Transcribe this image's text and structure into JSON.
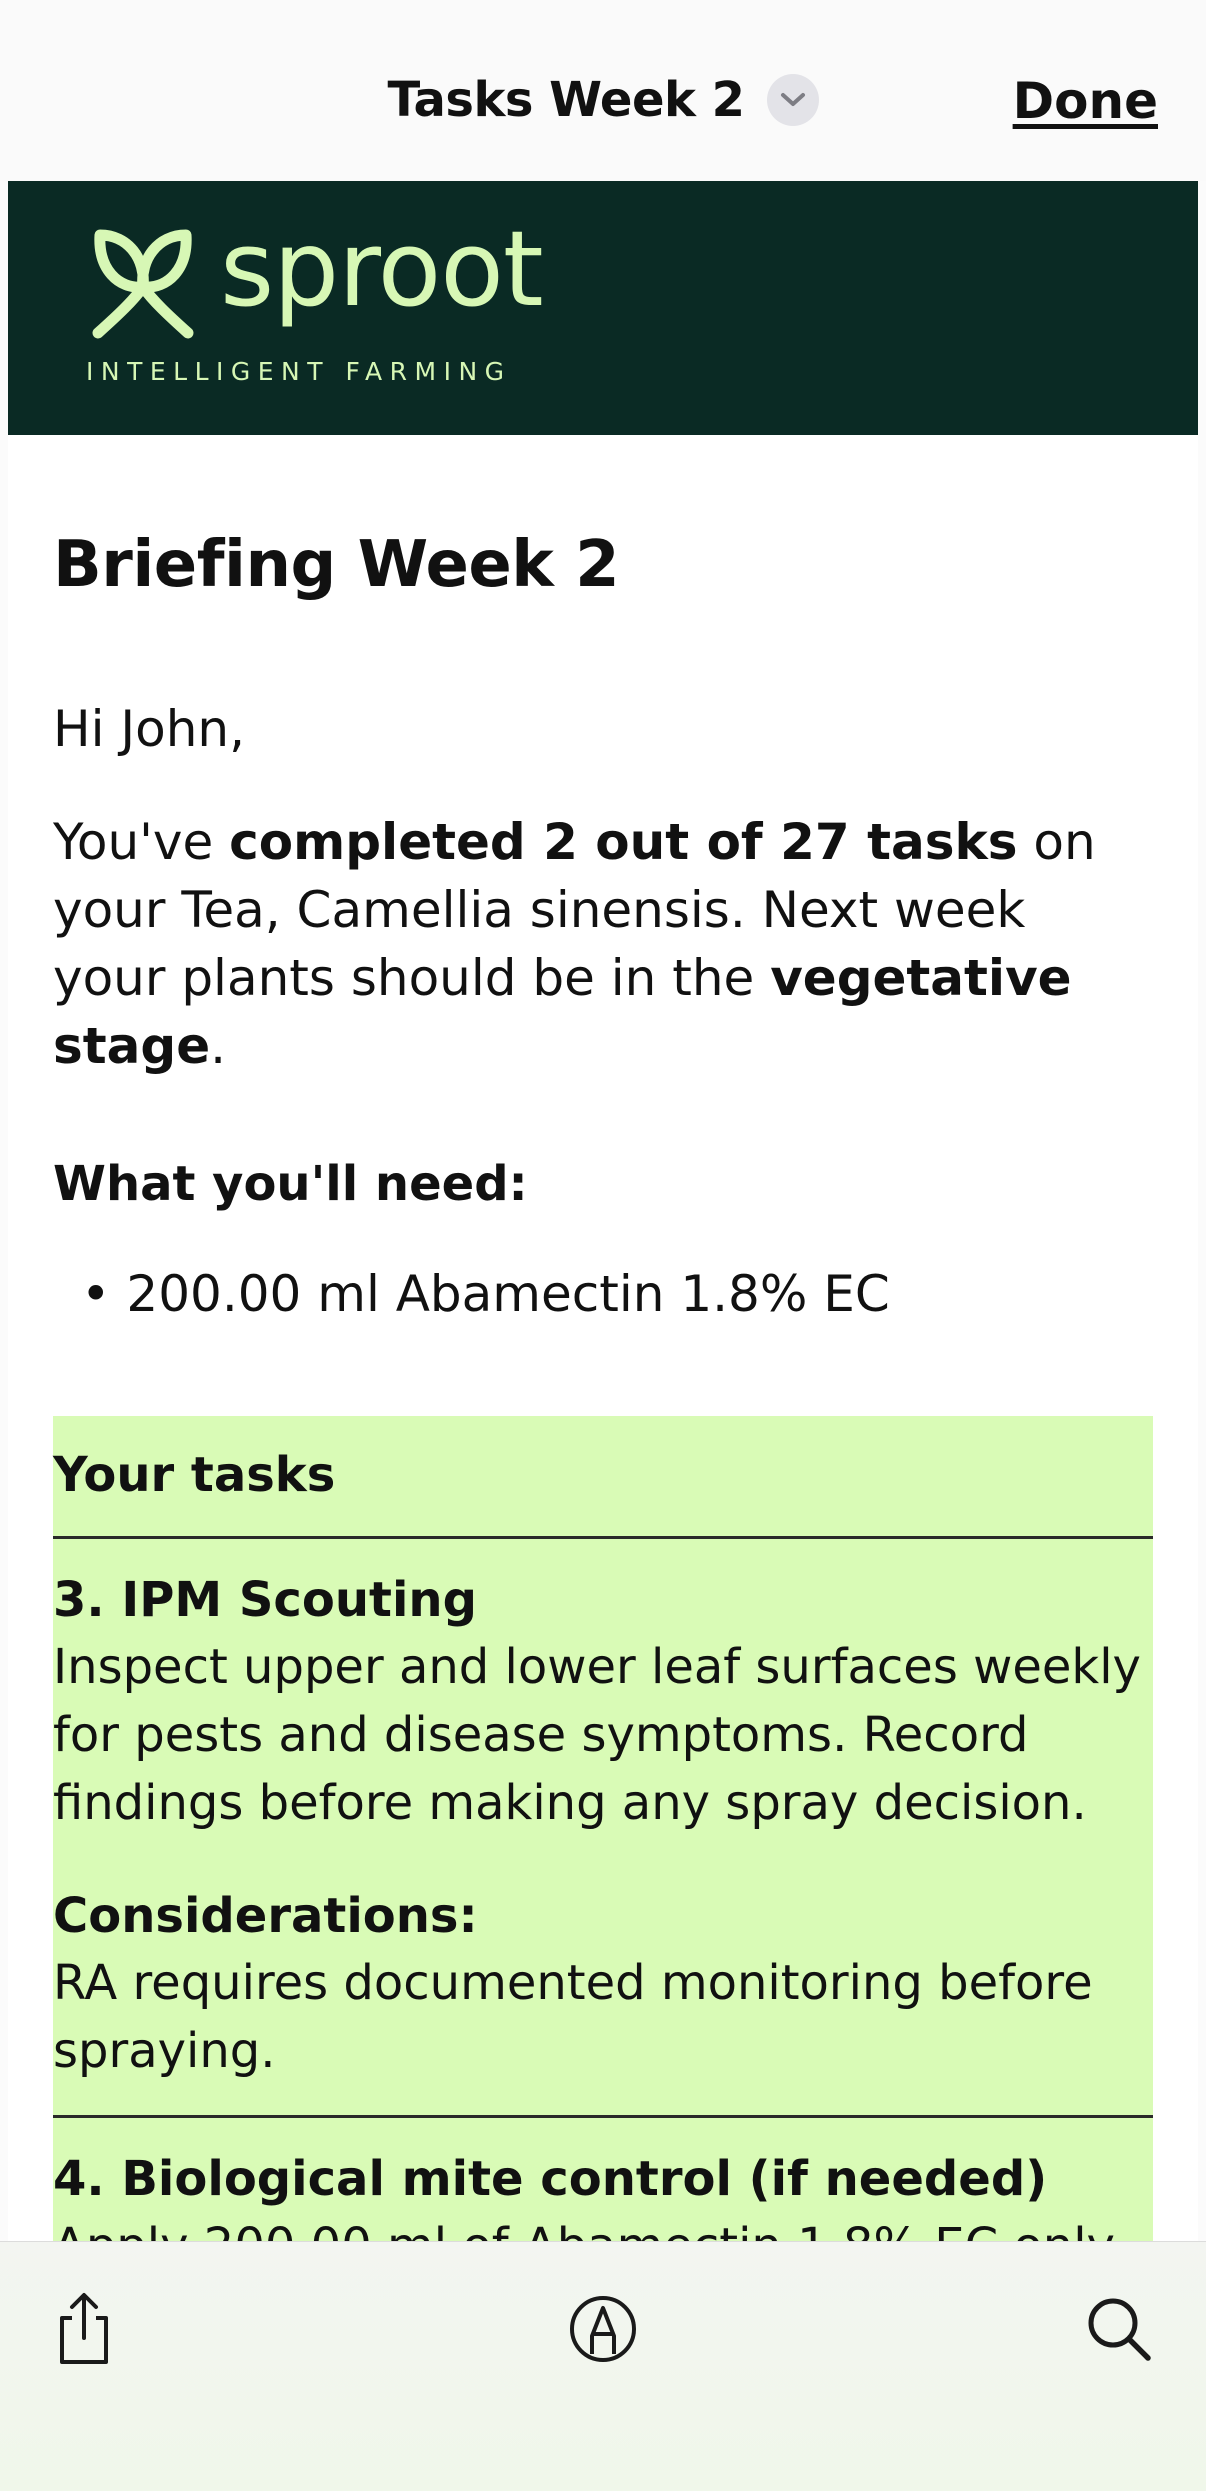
{
  "topbar": {
    "title": "Tasks Week 2",
    "done_label": "Done"
  },
  "brand": {
    "name": "sproot",
    "tagline": "INTELLIGENT FARMING",
    "bg_color": "#0a2a24",
    "accent_color": "#d7f7b5"
  },
  "briefing": {
    "heading": "Briefing Week 2",
    "greeting": "Hi John,",
    "summary_pre": "You've ",
    "summary_bold": "completed 2 out of 27 tasks",
    "summary_mid": " on your Tea, Camellia sinensis. Next week your plants should be in the ",
    "summary_stage": "vegetative stage",
    "summary_end": ".",
    "need_heading": "What you'll need:",
    "need_items": [
      "200.00 ml Abamectin 1.8% EC"
    ]
  },
  "tasks": {
    "heading": "Your tasks",
    "bg_color": "#d9fbb6",
    "items": [
      {
        "title": "3. IPM Scouting",
        "description": "Inspect upper and lower leaf surfaces weekly for pests and disease symptoms. Record findings before making any spray decision.",
        "considerations_label": "Considerations:",
        "considerations": "RA requires documented monitoring before spraying."
      },
      {
        "title": "4. Biological mite control (if needed)",
        "description": "Apply 200.00 ml of Abamectin 1.8% EC only"
      }
    ]
  },
  "toolbar": {
    "icons": [
      "share-icon",
      "markup-icon",
      "search-icon"
    ]
  }
}
